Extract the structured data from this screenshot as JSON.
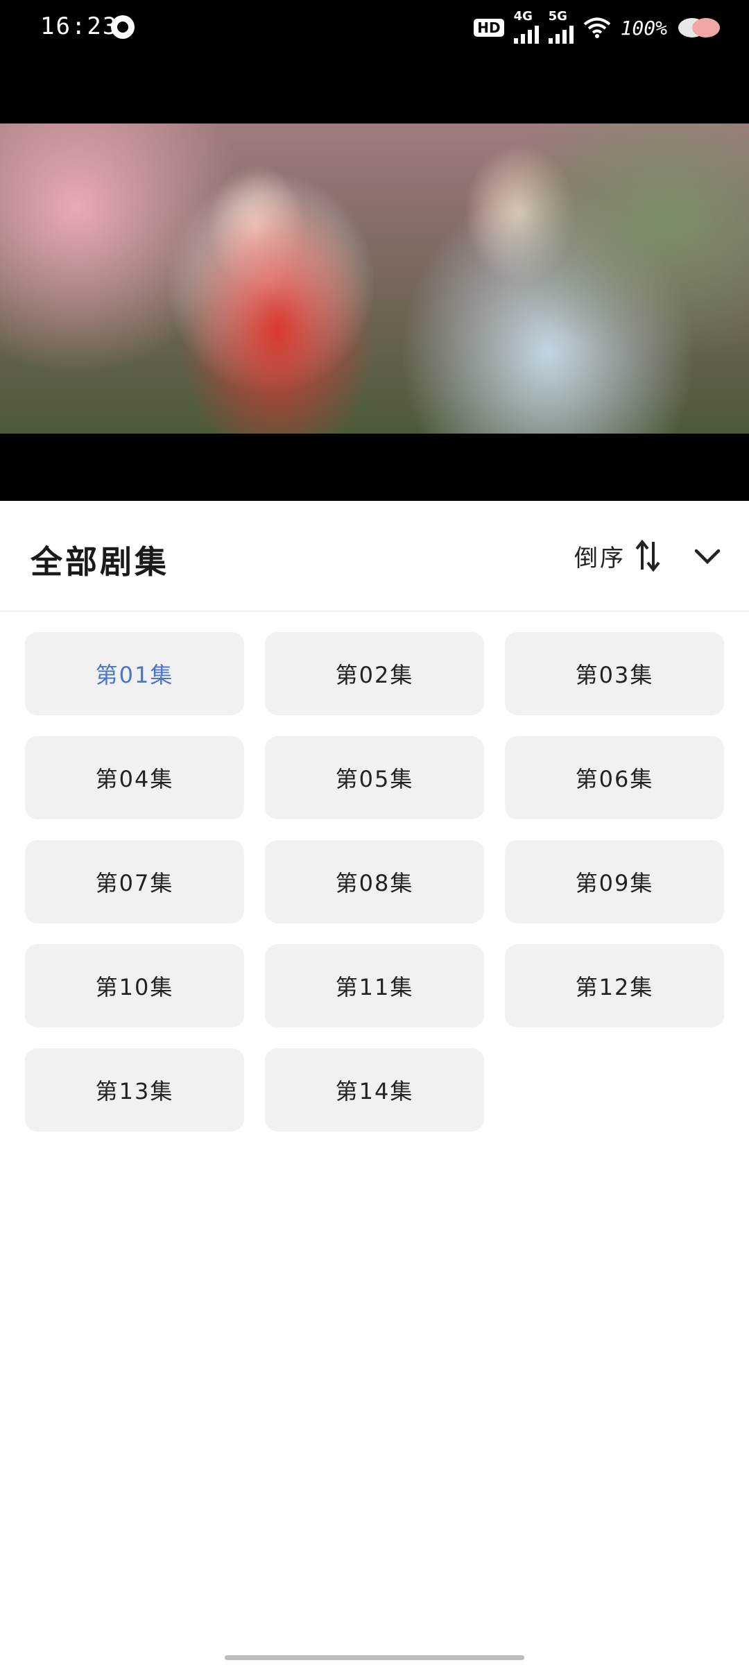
{
  "status_bar": {
    "time": "16:23",
    "hd_label": "HD",
    "network_1": "4G",
    "network_2": "5G",
    "battery": "100%",
    "icons": [
      "app-icon",
      "hd-icon",
      "signal-4g-icon",
      "signal-5g-icon",
      "wifi-icon",
      "battery-icon"
    ]
  },
  "video": {
    "description_icon": "video-frame"
  },
  "sheet": {
    "title": "全部剧集",
    "sort_label": "倒序",
    "sort_icon": "sort-icon",
    "collapse_icon": "chevron-down-icon",
    "accent_color": "#4a76c6"
  },
  "episodes": [
    {
      "label": "第01集",
      "active": true
    },
    {
      "label": "第02集",
      "active": false
    },
    {
      "label": "第03集",
      "active": false
    },
    {
      "label": "第04集",
      "active": false
    },
    {
      "label": "第05集",
      "active": false
    },
    {
      "label": "第06集",
      "active": false
    },
    {
      "label": "第07集",
      "active": false
    },
    {
      "label": "第08集",
      "active": false
    },
    {
      "label": "第09集",
      "active": false
    },
    {
      "label": "第10集",
      "active": false
    },
    {
      "label": "第11集",
      "active": false
    },
    {
      "label": "第12集",
      "active": false
    },
    {
      "label": "第13集",
      "active": false
    },
    {
      "label": "第14集",
      "active": false
    }
  ]
}
